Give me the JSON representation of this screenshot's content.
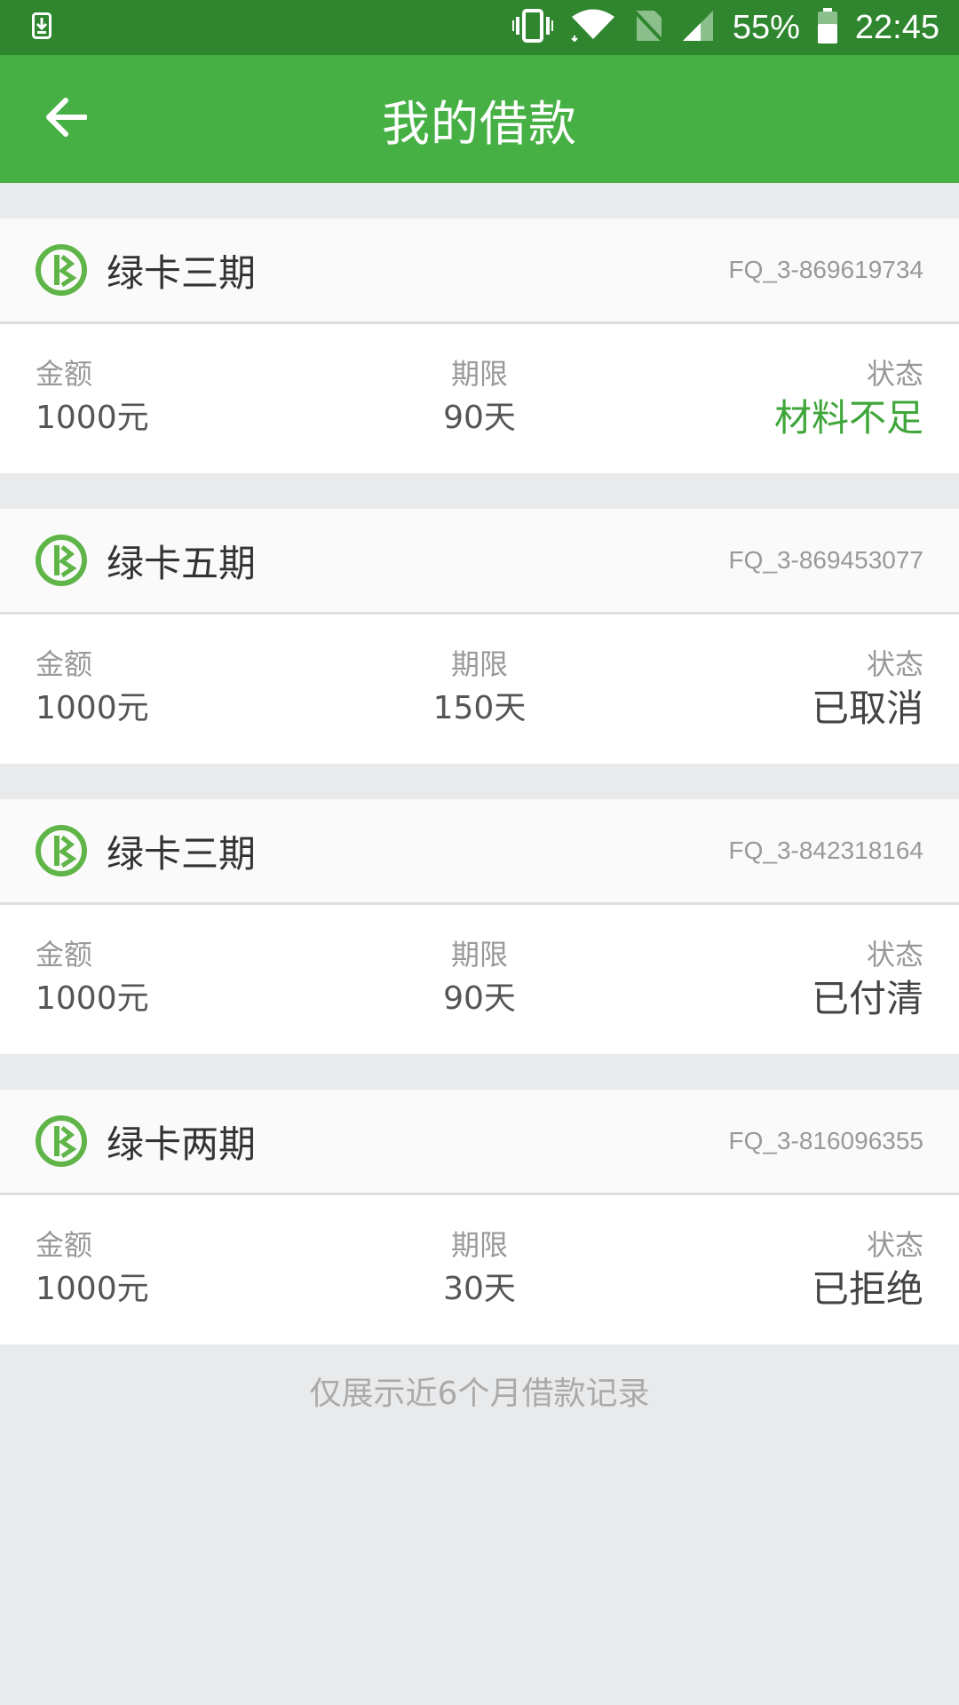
{
  "status_bar": {
    "battery": "55%",
    "time": "22:45",
    "icons": [
      "download-notification-icon",
      "vibrate-icon",
      "wifi-icon",
      "no-sim-icon",
      "signal-icon",
      "battery-icon"
    ]
  },
  "header": {
    "title": "我的借款",
    "back_icon": "back-arrow-icon"
  },
  "labels": {
    "amount": "金额",
    "term": "期限",
    "status": "状态"
  },
  "loans": [
    {
      "product": "绿卡三期",
      "order_no": "FQ_3-869619734",
      "amount": "1000元",
      "term": "90天",
      "status": "材料不足",
      "status_color": "#3fa63a"
    },
    {
      "product": "绿卡五期",
      "order_no": "FQ_3-869453077",
      "amount": "1000元",
      "term": "150天",
      "status": "已取消",
      "status_color": "#444444"
    },
    {
      "product": "绿卡三期",
      "order_no": "FQ_3-842318164",
      "amount": "1000元",
      "term": "90天",
      "status": "已付清",
      "status_color": "#444444"
    },
    {
      "product": "绿卡两期",
      "order_no": "FQ_3-816096355",
      "amount": "1000元",
      "term": "30天",
      "status": "已拒绝",
      "status_color": "#444444"
    }
  ],
  "footer_note": "仅展示近6个月借款记录",
  "colors": {
    "status_bar": "#2f862f",
    "app_bar": "#46b045",
    "brand_green": "#5fb548",
    "background": "#e9eaec"
  }
}
